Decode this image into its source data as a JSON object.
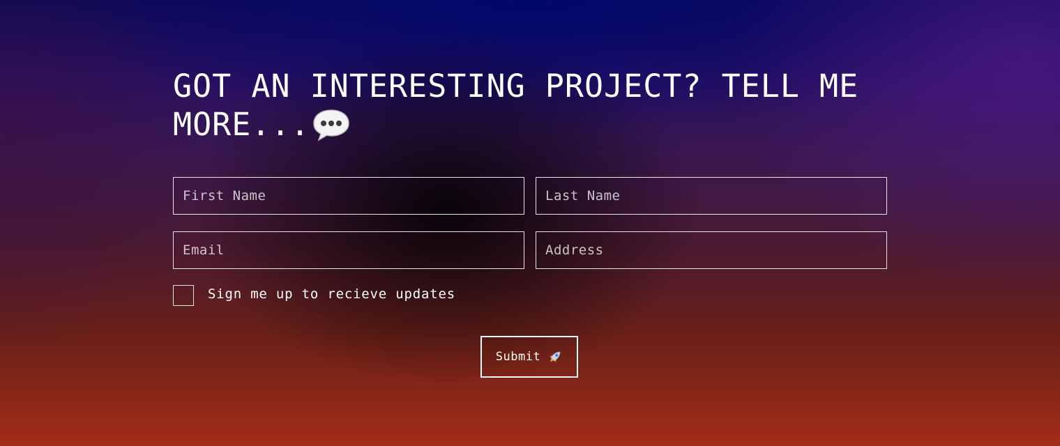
{
  "heading": {
    "text": "GOT AN INTERESTING PROJECT? TELL ME MORE...",
    "icon": "speech-bubble-icon"
  },
  "form": {
    "first_name": {
      "placeholder": "First Name",
      "value": ""
    },
    "last_name": {
      "placeholder": "Last Name",
      "value": ""
    },
    "email": {
      "placeholder": "Email",
      "value": ""
    },
    "address": {
      "placeholder": "Address",
      "value": ""
    },
    "signup": {
      "label": "Sign me up to recieve updates",
      "checked": false
    },
    "submit": {
      "label": "Submit",
      "icon": "rocket-icon"
    }
  },
  "colors": {
    "text": "#ffffff",
    "border": "#ffffff",
    "bg_top": "#0f0a55",
    "bg_bottom": "#a42c18"
  }
}
